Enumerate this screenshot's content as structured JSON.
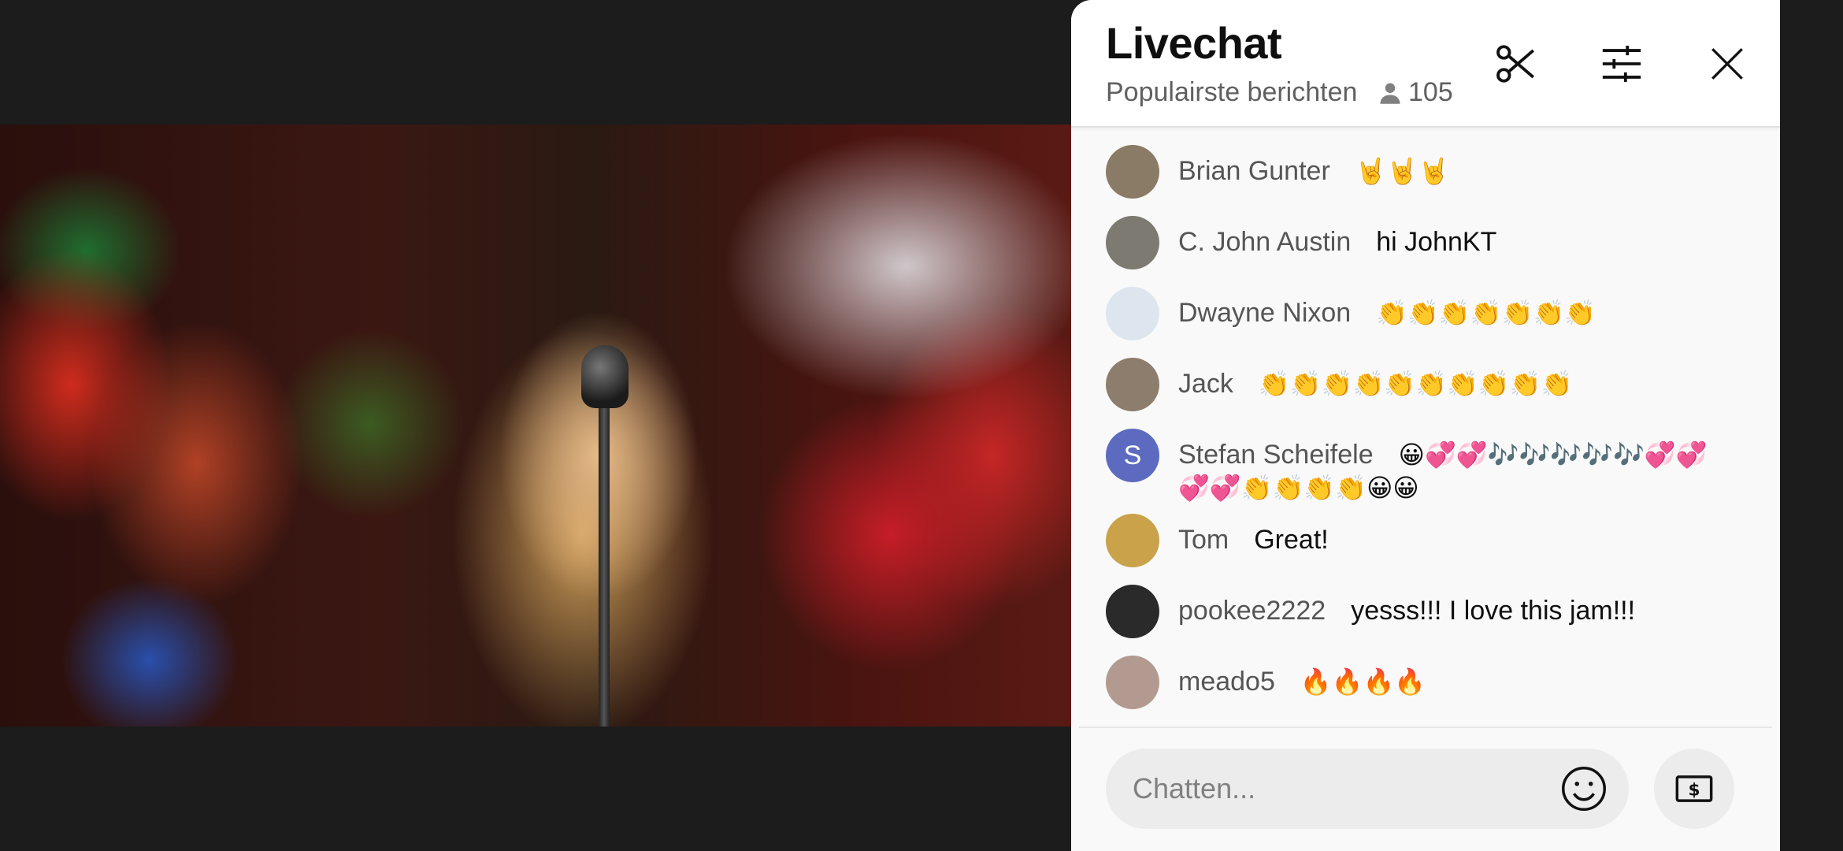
{
  "chat": {
    "title": "Livechat",
    "subtitle": "Populairste berichten",
    "viewer_count": "105",
    "input_placeholder": "Chatten..."
  },
  "messages": [
    {
      "author": "Brian Gunter",
      "text": "🤘🤘🤘",
      "avatar_color": "#8a7b66",
      "avatar_letter": ""
    },
    {
      "author": "C. John Austin",
      "text": "hi JohnKT",
      "avatar_color": "#7d7a72",
      "avatar_letter": ""
    },
    {
      "author": "Dwayne Nixon",
      "text": "👏👏👏👏👏👏👏",
      "avatar_color": "#dde6ef",
      "avatar_letter": ""
    },
    {
      "author": "Jack",
      "text": "👏👏👏👏👏👏👏👏👏👏",
      "avatar_color": "#8d7d6d",
      "avatar_letter": ""
    },
    {
      "author": "Stefan Scheifele",
      "text": "😀💞💞🎶🎶🎶🎶🎶💞💞💞💞👏👏👏👏😀😀",
      "avatar_color": "#5c6bc0",
      "avatar_letter": "S"
    },
    {
      "author": "Tom",
      "text": "Great!",
      "avatar_color": "#c9a24a",
      "avatar_letter": ""
    },
    {
      "author": "pookee2222",
      "text": "yesss!!! I love this jam!!!",
      "avatar_color": "#2a2a2a",
      "avatar_letter": ""
    },
    {
      "author": "meado5",
      "text": "🔥🔥🔥🔥",
      "avatar_color": "#b39a90",
      "avatar_letter": ""
    }
  ],
  "icons": {
    "clip": "scissors-icon",
    "filter": "sliders-icon",
    "close": "close-icon",
    "viewers": "person-icon",
    "emoji": "smiley-icon",
    "superchat": "dollar-bill-icon"
  },
  "colors": {
    "panel_bg": "#f9f9f9",
    "header_bg": "#ffffff",
    "page_bg": "#1c1c1c"
  }
}
